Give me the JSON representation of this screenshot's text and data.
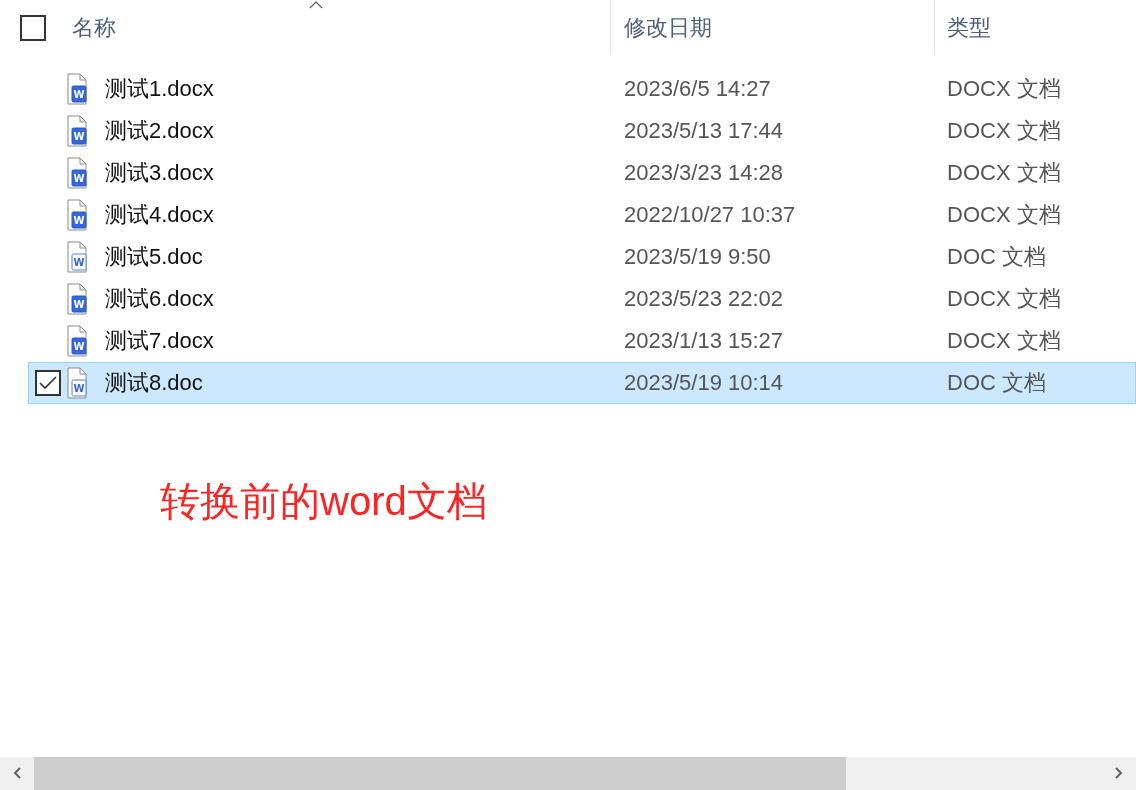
{
  "header": {
    "select_all_checked": false,
    "columns": [
      {
        "label": "名称",
        "sorted": true
      },
      {
        "label": "修改日期",
        "sorted": false
      },
      {
        "label": "类型",
        "sorted": false
      }
    ]
  },
  "files": [
    {
      "name": "测试1.docx",
      "kind": "docx",
      "icon_letter": "W",
      "modified": "2023/6/5 14:27",
      "type": "DOCX 文档",
      "selected": false
    },
    {
      "name": "测试2.docx",
      "kind": "docx",
      "icon_letter": "W",
      "modified": "2023/5/13 17:44",
      "type": "DOCX 文档",
      "selected": false
    },
    {
      "name": "测试3.docx",
      "kind": "docx",
      "icon_letter": "W",
      "modified": "2023/3/23 14:28",
      "type": "DOCX 文档",
      "selected": false
    },
    {
      "name": "测试4.docx",
      "kind": "docx",
      "icon_letter": "W",
      "modified": "2022/10/27 10:37",
      "type": "DOCX 文档",
      "selected": false
    },
    {
      "name": "测试5.doc",
      "kind": "doc",
      "icon_letter": "W",
      "modified": "2023/5/19 9:50",
      "type": "DOC 文档",
      "selected": false
    },
    {
      "name": "测试6.docx",
      "kind": "docx",
      "icon_letter": "W",
      "modified": "2023/5/23 22:02",
      "type": "DOCX 文档",
      "selected": false
    },
    {
      "name": "测试7.docx",
      "kind": "docx",
      "icon_letter": "W",
      "modified": "2023/1/13 15:27",
      "type": "DOCX 文档",
      "selected": false
    },
    {
      "name": "测试8.doc",
      "kind": "doc",
      "icon_letter": "W",
      "modified": "2023/5/19 10:14",
      "type": "DOC 文档",
      "selected": true
    }
  ],
  "annotation": "转换前的word文档"
}
